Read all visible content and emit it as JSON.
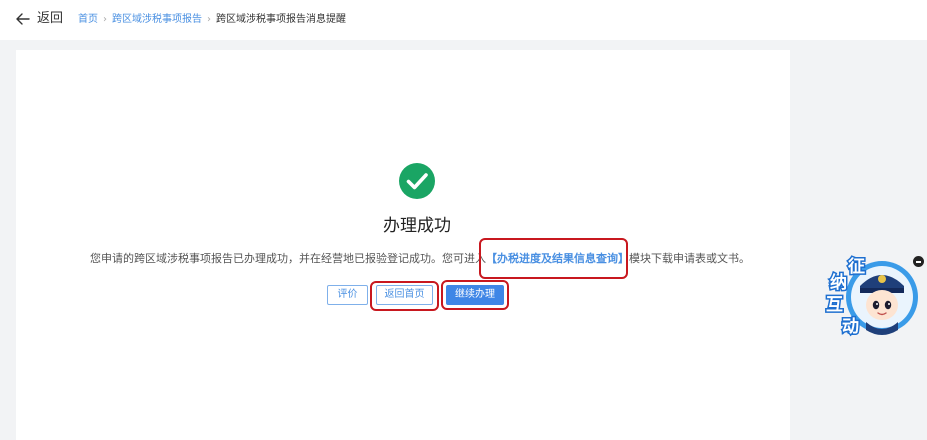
{
  "header": {
    "back_label": "返回",
    "breadcrumb": [
      {
        "label": "首页"
      },
      {
        "label": "跨区域涉税事项报告"
      },
      {
        "label": "跨区域涉税事项报告消息提醒"
      }
    ],
    "separator": "›"
  },
  "result": {
    "icon": "check-circle-icon",
    "title": "办理成功",
    "message_before": "您申请的跨区域涉税事项报告已办理成功，并在经营地已报验登记成功。您可进入",
    "message_link": "【办税进度及结果信息查询】",
    "message_after": "模块下载申请表或文书。",
    "success_color": "#1aa564"
  },
  "actions": {
    "rate_label": "评价",
    "home_label": "返回首页",
    "continue_label": "继续办理"
  },
  "mascot": {
    "chars": [
      "征",
      "纳",
      "互",
      "动"
    ]
  },
  "colors": {
    "accent": "#3f86e6",
    "highlight_box": "#c8181f"
  }
}
